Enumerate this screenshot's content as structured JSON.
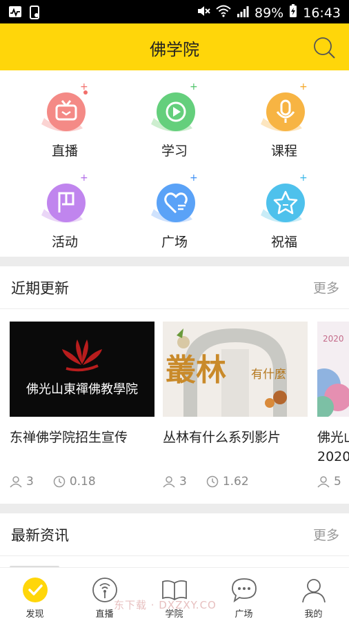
{
  "status_bar": {
    "battery": "89%",
    "time": "16:43"
  },
  "header": {
    "title": "佛学院"
  },
  "categories": [
    {
      "label": "直播",
      "icon": "tv-icon",
      "color": "#f26f6b"
    },
    {
      "label": "学习",
      "icon": "play-circle-icon",
      "color": "#4fc36a"
    },
    {
      "label": "课程",
      "icon": "microphone-icon",
      "color": "#f5a623"
    },
    {
      "label": "活动",
      "icon": "flag-icon",
      "color": "#b06ae8"
    },
    {
      "label": "广场",
      "icon": "heart-chat-icon",
      "color": "#3d8ff5"
    },
    {
      "label": "祝福",
      "icon": "star-icon",
      "color": "#36b6e8"
    }
  ],
  "recent": {
    "title": "近期更新",
    "more": "更多",
    "items": [
      {
        "thumb_text": "佛光山東禪佛教學院",
        "title": "东禅佛学院招生宣传",
        "views": "3",
        "duration": "0.18"
      },
      {
        "thumb_text": "叢林",
        "thumb_sub": "有什麼",
        "title": "丛林有什么系列影片",
        "views": "3",
        "duration": "1.62"
      },
      {
        "thumb_text": "2020",
        "title": "佛光山",
        "title2": "2020",
        "views": "5",
        "duration": ""
      }
    ]
  },
  "news": {
    "title": "最新资讯",
    "more": "更多"
  },
  "tabs": [
    {
      "label": "发现",
      "icon": "discover-icon"
    },
    {
      "label": "直播",
      "icon": "broadcast-icon"
    },
    {
      "label": "学院",
      "icon": "book-icon"
    },
    {
      "label": "广场",
      "icon": "chat-bubble-icon"
    },
    {
      "label": "我的",
      "icon": "user-icon"
    }
  ],
  "watermark": "东下载 · DXZXY.CO"
}
